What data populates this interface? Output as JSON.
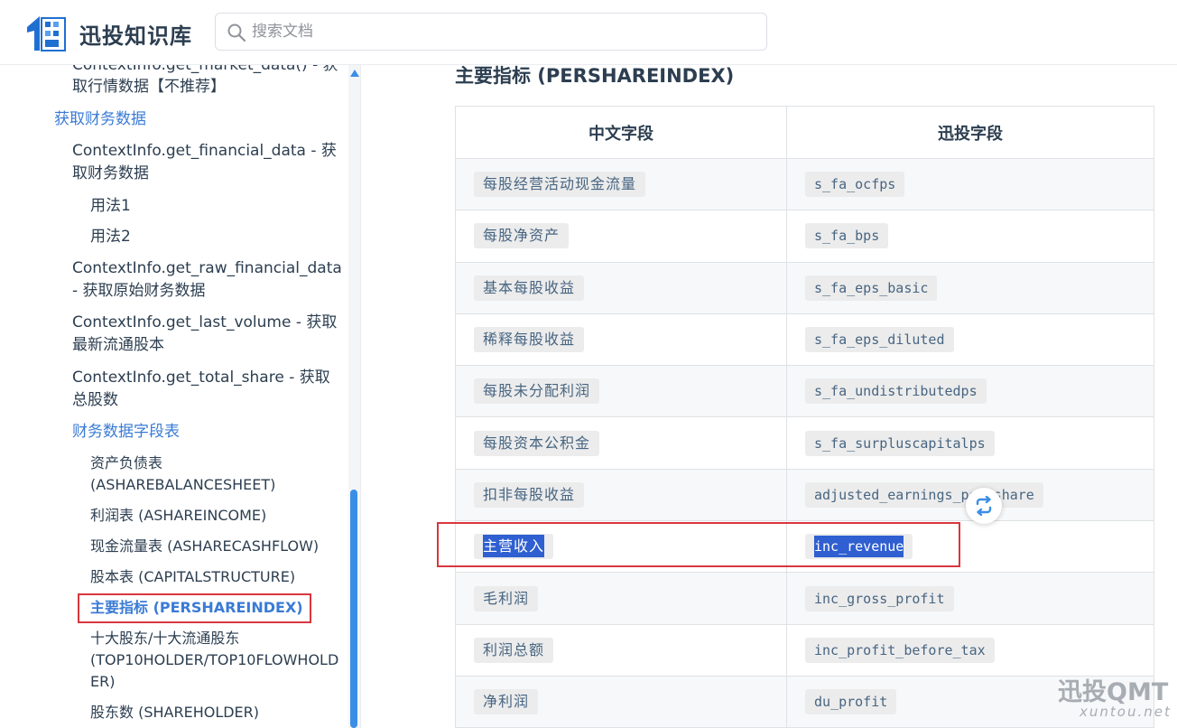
{
  "header": {
    "brand": "迅投知识库",
    "search_placeholder": "搜索文档"
  },
  "sidebar": {
    "items": [
      {
        "text": "ContextInfo.get_market_data() - 获",
        "type": "item"
      },
      {
        "text": "取行情数据【不推荐】",
        "type": "item"
      },
      {
        "text": "获取财务数据",
        "type": "group"
      },
      {
        "text": "ContextInfo.get_financial_data - 获",
        "type": "item"
      },
      {
        "text": "取财务数据",
        "type": "item"
      },
      {
        "text": "用法1",
        "type": "sub"
      },
      {
        "text": "用法2",
        "type": "sub"
      },
      {
        "text": "ContextInfo.get_raw_financial_data",
        "type": "item"
      },
      {
        "text": "- 获取原始财务数据",
        "type": "item"
      },
      {
        "text": "ContextInfo.get_last_volume - 获取",
        "type": "item"
      },
      {
        "text": "最新流通股本",
        "type": "item"
      },
      {
        "text": "ContextInfo.get_total_share - 获取",
        "type": "item"
      },
      {
        "text": "总股数",
        "type": "item"
      },
      {
        "text": "财务数据字段表",
        "type": "group"
      },
      {
        "text": "资产负债表",
        "type": "sub"
      },
      {
        "text": "(ASHAREBALANCESHEET)",
        "type": "sub"
      },
      {
        "text": "利润表 (ASHAREINCOME)",
        "type": "sub"
      },
      {
        "text": "现金流量表 (ASHARECASHFLOW)",
        "type": "sub"
      },
      {
        "text": "股本表 (CAPITALSTRUCTURE)",
        "type": "sub"
      },
      {
        "text": "主要指标 (PERSHAREINDEX)",
        "type": "active"
      },
      {
        "text": "十大股东/十大流通股东",
        "type": "sub"
      },
      {
        "text": "(TOP10HOLDER/TOP10FLOWHOLD",
        "type": "sub"
      },
      {
        "text": "ER)",
        "type": "sub"
      },
      {
        "text": "股东数 (SHAREHOLDER)",
        "type": "sub"
      }
    ]
  },
  "main": {
    "section_title": "主要指标 (PERSHAREINDEX)",
    "table": {
      "headers": [
        "中文字段",
        "迅投字段"
      ],
      "rows": [
        [
          "每股经营活动现金流量",
          "s_fa_ocfps"
        ],
        [
          "每股净资产",
          "s_fa_bps"
        ],
        [
          "基本每股收益",
          "s_fa_eps_basic"
        ],
        [
          "稀释每股收益",
          "s_fa_eps_diluted"
        ],
        [
          "每股未分配利润",
          "s_fa_undistributedps"
        ],
        [
          "每股资本公积金",
          "s_fa_surpluscapitalps"
        ],
        [
          "扣非每股收益",
          "adjusted_earnings_per_share"
        ],
        [
          "主营收入",
          "inc_revenue"
        ],
        [
          "毛利润",
          "inc_gross_profit"
        ],
        [
          "利润总额",
          "inc_profit_before_tax"
        ],
        [
          "净利润",
          "du_profit"
        ]
      ]
    }
  },
  "watermark": {
    "main": "迅投QMT",
    "sub": "xuntou.net"
  },
  "colors": {
    "accent": "#3a7bd5",
    "highlight_border": "#d9363e",
    "selection": "#2f5fd0"
  }
}
